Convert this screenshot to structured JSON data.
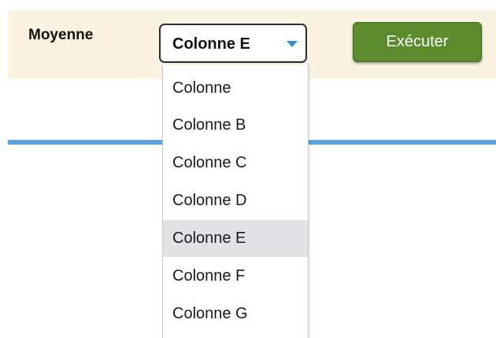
{
  "toolbar": {
    "label": "Moyenne",
    "select_value": "Colonne E",
    "run_button_label": "Exécuter"
  },
  "dropdown": {
    "selected_index": 4,
    "options": [
      "Colonne",
      "Colonne B",
      "Colonne C",
      "Colonne D",
      "Colonne E",
      "Colonne F",
      "Colonne G"
    ]
  },
  "icons": {
    "select_caret": "chevron-down-icon"
  },
  "colors": {
    "toolbar_background": "#fbf3e2",
    "run_button": "#5c8b2e",
    "caret": "#2f8fd8",
    "divider": "#5aa3de",
    "selected_option": "#e2e1e6"
  }
}
